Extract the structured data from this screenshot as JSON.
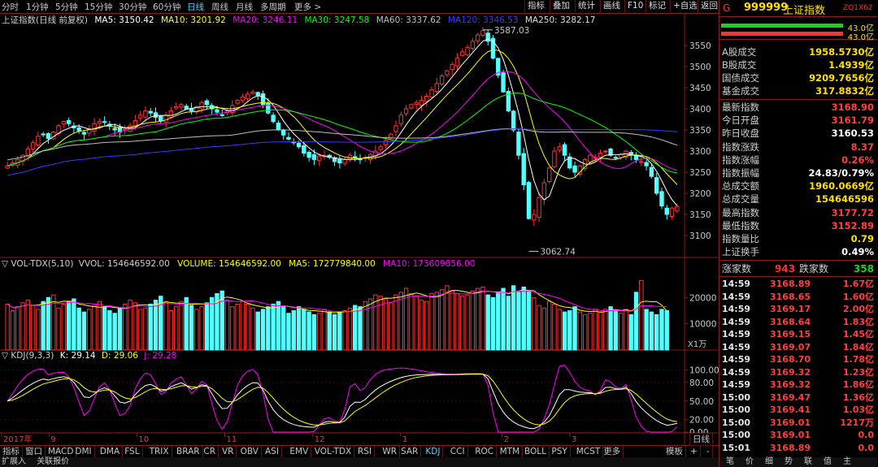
{
  "periods": [
    "分时",
    "1分钟",
    "5分钟",
    "15分钟",
    "30分钟",
    "60分钟",
    "日线",
    "周线",
    "月线",
    "多周期",
    "更多 >"
  ],
  "active_period": "日线",
  "toolbar_right": [
    "指标",
    "叠加",
    "统计",
    "画线",
    "F10",
    "标记",
    "+自选",
    "返回"
  ],
  "legend": {
    "title": "上证指数(日线 前复权)",
    "ma5": "MA5: 3150.42",
    "ma10": "MA10: 3201.92",
    "ma20": "MA20: 3246.11",
    "ma30": "MA30: 3247.58",
    "ma60": "MA60: 3337.62",
    "ma120": "MA120: 3346.53",
    "ma250": "MA250: 3282.17"
  },
  "annotations": {
    "high": "3587.03",
    "low": "3062.74"
  },
  "vol_legend": {
    "name": "VOL-TDX(5,10)",
    "vvol": "VVOL: 154646592.00",
    "volume": "VOLUME: 154646592.00",
    "ma5": "MA5: 172779840.00",
    "ma10": "MA10: 173609856.00"
  },
  "vol_unit": "X1万",
  "kdj_legend": {
    "name": "KDJ(9,3,3)",
    "k": "K: 29.14",
    "d": "D: 29.06",
    "j": "J: 29.28"
  },
  "price_axis": [
    "3550",
    "3500",
    "3450",
    "3400",
    "3350",
    "3300",
    "3250",
    "3200",
    "3150",
    "3100"
  ],
  "vol_axis": [
    "20000",
    "10000"
  ],
  "kdj_axis": [
    "100.00",
    "80.00",
    "50.00",
    "20.00",
    "0.00"
  ],
  "date_axis": [
    {
      "label": "2017年"
    },
    {
      "label": "9"
    },
    {
      "label": "10"
    },
    {
      "label": "11"
    },
    {
      "label": "12"
    },
    {
      "label": "1"
    },
    {
      "label": "2"
    },
    {
      "label": "3"
    }
  ],
  "bottom_tabs": [
    "指标",
    "窗口",
    "MACD",
    "DMI",
    "DMA",
    "FSL",
    "TRIX",
    "BRAR",
    "CR",
    "VR",
    "OBV",
    "ASI",
    "EMV",
    "VOL-TDX",
    "RSI",
    "WR",
    "SAR",
    "KDJ",
    "CCI",
    "ROC",
    "MTM",
    "BOLL",
    "PSY",
    "MCST",
    "更多"
  ],
  "active_tab": "KDJ",
  "bottom_right": [
    "模板",
    "+",
    "-"
  ],
  "bottom_right_tab": "日线",
  "status": [
    "扩展入",
    "关联报价"
  ],
  "quote": {
    "flag": "G",
    "code": "999999",
    "name": "上证指数",
    "badge": "ZQ1X62",
    "bar1": "43.0亿",
    "bar2": "43.0亿",
    "stats1": [
      {
        "label": "A股成交",
        "value": "1958.5730亿"
      },
      {
        "label": "B股成交",
        "value": "1.4939亿"
      },
      {
        "label": "国债成交",
        "value": "9209.7656亿"
      },
      {
        "label": "基金成交",
        "value": "317.8832亿"
      }
    ],
    "stats2": [
      {
        "label": "最新指数",
        "value": "3168.90",
        "color": "red"
      },
      {
        "label": "今日开盘",
        "value": "3161.79",
        "color": "red"
      },
      {
        "label": "昨日收盘",
        "value": "3160.53",
        "color": "white"
      },
      {
        "label": "指数涨跌",
        "value": "8.37",
        "color": "red"
      },
      {
        "label": "指数涨幅",
        "value": "0.26%",
        "color": "red"
      },
      {
        "label": "指数振幅",
        "value": "24.83/0.79%",
        "color": "white"
      },
      {
        "label": "总成交额",
        "value": "1960.0669亿",
        "color": "yellow"
      },
      {
        "label": "总成交量",
        "value": "154646596",
        "color": "yellow"
      },
      {
        "label": "最高指数",
        "value": "3177.72",
        "color": "red"
      },
      {
        "label": "最低指数",
        "value": "3152.89",
        "color": "red"
      },
      {
        "label": "指数量比",
        "value": "0.79",
        "color": "yellow"
      },
      {
        "label": "上证换手",
        "value": "0.49%",
        "color": "white"
      }
    ],
    "advance_label": "涨家数",
    "advance": "943",
    "decline_label": "跌家数",
    "decline": "358",
    "ticks": [
      {
        "t": "14:59",
        "p": "3168.89",
        "a": "1.67亿"
      },
      {
        "t": "14:59",
        "p": "3168.65",
        "a": "1.60亿"
      },
      {
        "t": "14:59",
        "p": "3169.17",
        "a": "2.00亿"
      },
      {
        "t": "14:59",
        "p": "3168.64",
        "a": "1.83亿"
      },
      {
        "t": "14:59",
        "p": "3169.15",
        "a": "1.45亿"
      },
      {
        "t": "14:59",
        "p": "3169.07",
        "a": "1.84亿"
      },
      {
        "t": "14:59",
        "p": "3168.70",
        "a": "1.78亿"
      },
      {
        "t": "14:59",
        "p": "3169.32",
        "a": "1.23亿"
      },
      {
        "t": "14:59",
        "p": "3169.32",
        "a": "1.86亿"
      },
      {
        "t": "15:00",
        "p": "3169.47",
        "a": "1.36亿"
      },
      {
        "t": "15:00",
        "p": "3169.41",
        "a": "1.03亿"
      },
      {
        "t": "15:00",
        "p": "3169.01",
        "a": "1217万"
      },
      {
        "t": "15:00",
        "p": "3169.01",
        "a": "0.0"
      },
      {
        "t": "15:01",
        "p": "3168.89",
        "a": "0.0"
      }
    ],
    "bottom_tabs": [
      "笔",
      "价",
      "细",
      "势",
      "联",
      "值",
      "主"
    ]
  },
  "colors": {
    "up": "#ff3232",
    "down": "#54ffff",
    "ma5": "#ffffff",
    "ma10": "#ffff00",
    "ma20": "#ff00ff",
    "ma30": "#00ff00",
    "ma60": "#c0c0c0",
    "ma120": "#3a3aff",
    "ma250": "#cccccc",
    "kdj_k": "#ffffff",
    "kdj_d": "#ffff00",
    "kdj_j": "#ff00ff",
    "grid": "#8a1c1c"
  },
  "chart_data": {
    "type": "candlestick",
    "price_range": [
      3050,
      3600
    ],
    "closes": [
      3265,
      3272,
      3280,
      3290,
      3305,
      3320,
      3335,
      3340,
      3330,
      3345,
      3360,
      3370,
      3365,
      3355,
      3348,
      3340,
      3352,
      3365,
      3370,
      3368,
      3360,
      3350,
      3345,
      3352,
      3360,
      3372,
      3385,
      3395,
      3390,
      3380,
      3372,
      3385,
      3395,
      3405,
      3410,
      3400,
      3395,
      3405,
      3415,
      3410,
      3400,
      3392,
      3385,
      3395,
      3408,
      3420,
      3428,
      3435,
      3440,
      3432,
      3410,
      3390,
      3370,
      3350,
      3338,
      3328,
      3320,
      3310,
      3295,
      3285,
      3280,
      3288,
      3290,
      3285,
      3275,
      3272,
      3280,
      3290,
      3285,
      3280,
      3285,
      3292,
      3300,
      3310,
      3325,
      3340,
      3360,
      3385,
      3400,
      3410,
      3415,
      3420,
      3430,
      3445,
      3460,
      3478,
      3490,
      3505,
      3520,
      3535,
      3545,
      3560,
      3575,
      3585,
      3560,
      3520,
      3480,
      3440,
      3395,
      3350,
      3290,
      3220,
      3140,
      3150,
      3190,
      3225,
      3260,
      3300,
      3310,
      3290,
      3260,
      3250,
      3265,
      3280,
      3290,
      3285,
      3295,
      3300,
      3290,
      3285,
      3292,
      3300,
      3290,
      3280,
      3275,
      3265,
      3240,
      3200,
      3170,
      3150,
      3165,
      3168
    ],
    "volume_range": [
      0,
      30000
    ],
    "volumes": [
      17500,
      15000,
      16500,
      18000,
      19000,
      17000,
      15500,
      18500,
      20000,
      21000,
      16000,
      17500,
      18500,
      19500,
      16000,
      14500,
      15500,
      17000,
      18500,
      16500,
      15000,
      14000,
      16000,
      17500,
      19000,
      18000,
      15500,
      16000,
      17500,
      19000,
      20500,
      18500,
      15000,
      16500,
      18500,
      20000,
      17000,
      15500,
      16500,
      18000,
      20000,
      21500,
      22500,
      19000,
      16500,
      17500,
      18500,
      17500,
      16000,
      14500,
      15500,
      16500,
      17500,
      18500,
      16500,
      14000,
      15000,
      16500,
      15500,
      14500,
      13500,
      14000,
      15500,
      14500,
      13500,
      14500,
      15000,
      16000,
      17000,
      16500,
      18500,
      19500,
      21000,
      20500,
      19500,
      18000,
      21000,
      22000,
      23500,
      21500,
      20500,
      19000,
      18500,
      21500,
      22000,
      23000,
      24500,
      22500,
      21500,
      20500,
      21000,
      22500,
      23500,
      24000,
      21000,
      20000,
      22000,
      23500,
      20500,
      24500,
      22000,
      24000,
      22500,
      20000,
      17000,
      16000,
      18500,
      17500,
      15500,
      14500,
      15000,
      16500,
      14500,
      13500,
      14000,
      15500,
      14500,
      15500,
      16500,
      15000,
      14000,
      15500,
      13500,
      22000,
      26500,
      15500,
      14500,
      13500,
      15500,
      15000
    ],
    "kdj_range": [
      0,
      110
    ]
  }
}
